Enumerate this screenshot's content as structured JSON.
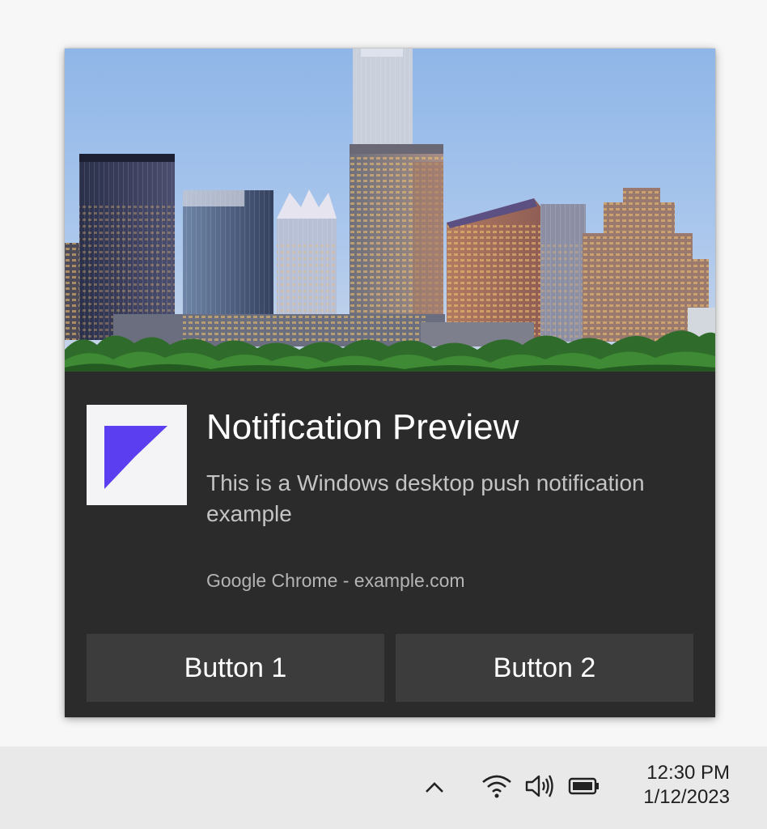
{
  "notification": {
    "title": "Notification Preview",
    "body": "This is a Windows desktop push notification example",
    "attribution": "Google Chrome - example.com",
    "buttons": [
      {
        "label": "Button 1"
      },
      {
        "label": "Button 2"
      }
    ],
    "hero_image": "city-skyline-photo",
    "app_logo": "purple-triangle-logo"
  },
  "taskbar": {
    "tray_icons": [
      "chevron-up-icon",
      "wifi-icon",
      "volume-icon",
      "battery-icon"
    ],
    "clock": {
      "time": "12:30 PM",
      "date": "1/12/2023"
    }
  },
  "colors": {
    "toast_background": "#2b2b2b",
    "button_background": "#3c3c3c",
    "logo_accent": "#5b3ef0",
    "taskbar_background": "#e9e9e9"
  }
}
